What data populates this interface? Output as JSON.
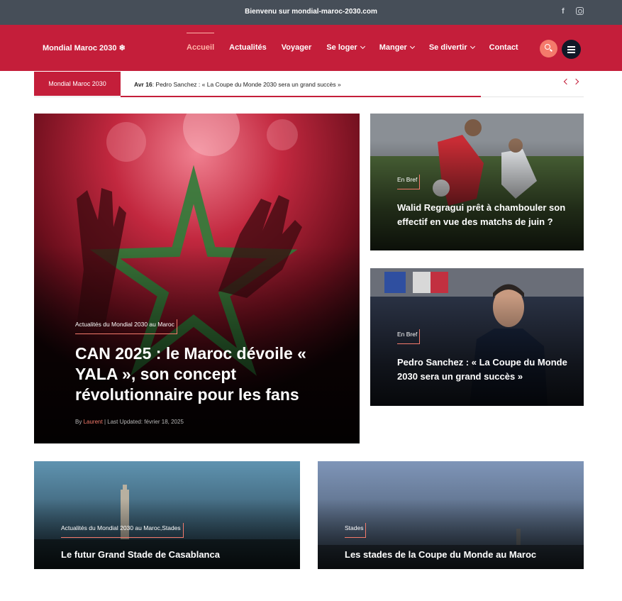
{
  "topbar": {
    "welcome": "Bienvenu sur mondial-maroc-2030.com",
    "social_icons": [
      "facebook-icon",
      "instagram-icon"
    ]
  },
  "header": {
    "logo": "Mondial Maroc 2030 ❄",
    "nav": [
      {
        "label": "Accueil",
        "active": true
      },
      {
        "label": "Actualités"
      },
      {
        "label": "Voyager"
      },
      {
        "label": "Se loger",
        "dropdown": true
      },
      {
        "label": "Manger",
        "dropdown": true
      },
      {
        "label": "Se divertir",
        "dropdown": true
      },
      {
        "label": "Contact"
      }
    ],
    "icons": [
      "search-icon",
      "menu-icon"
    ]
  },
  "ticker": {
    "label": "Mondial Maroc 2030",
    "date": "Avr 16",
    "separator": ": ",
    "headline": "Pedro Sanchez : « La Coupe du Monde 2030 sera un grand succès »"
  },
  "featured": {
    "category": "Actualités du Mondial 2030 au Maroc",
    "title": "CAN 2025 : le Maroc dévoile « YALA », son concept révolutionnaire pour les fans",
    "by": "By",
    "author": "Laurent",
    "updated": "Last Updated: février 18, 2025"
  },
  "side_cards": [
    {
      "category": "En Bref",
      "title": "Walid Regragui prêt à chambouler son effectif en vue des matchs de juin ?"
    },
    {
      "category": "En Bref",
      "title": "Pedro Sanchez : « La Coupe du Monde 2030 sera un grand succès »"
    }
  ],
  "bottom_cards": [
    {
      "category": "Actualités du Mondial 2030 au Maroc,Stades",
      "title": "Le futur Grand Stade de Casablanca"
    },
    {
      "category": "Stades",
      "title": "Les stades de la Coupe du Monde au Maroc"
    }
  ],
  "colors": {
    "topbar": "#464e58",
    "brand_red": "#c41e3a",
    "accent_coral": "#f47a6b",
    "dark": "#111827"
  }
}
